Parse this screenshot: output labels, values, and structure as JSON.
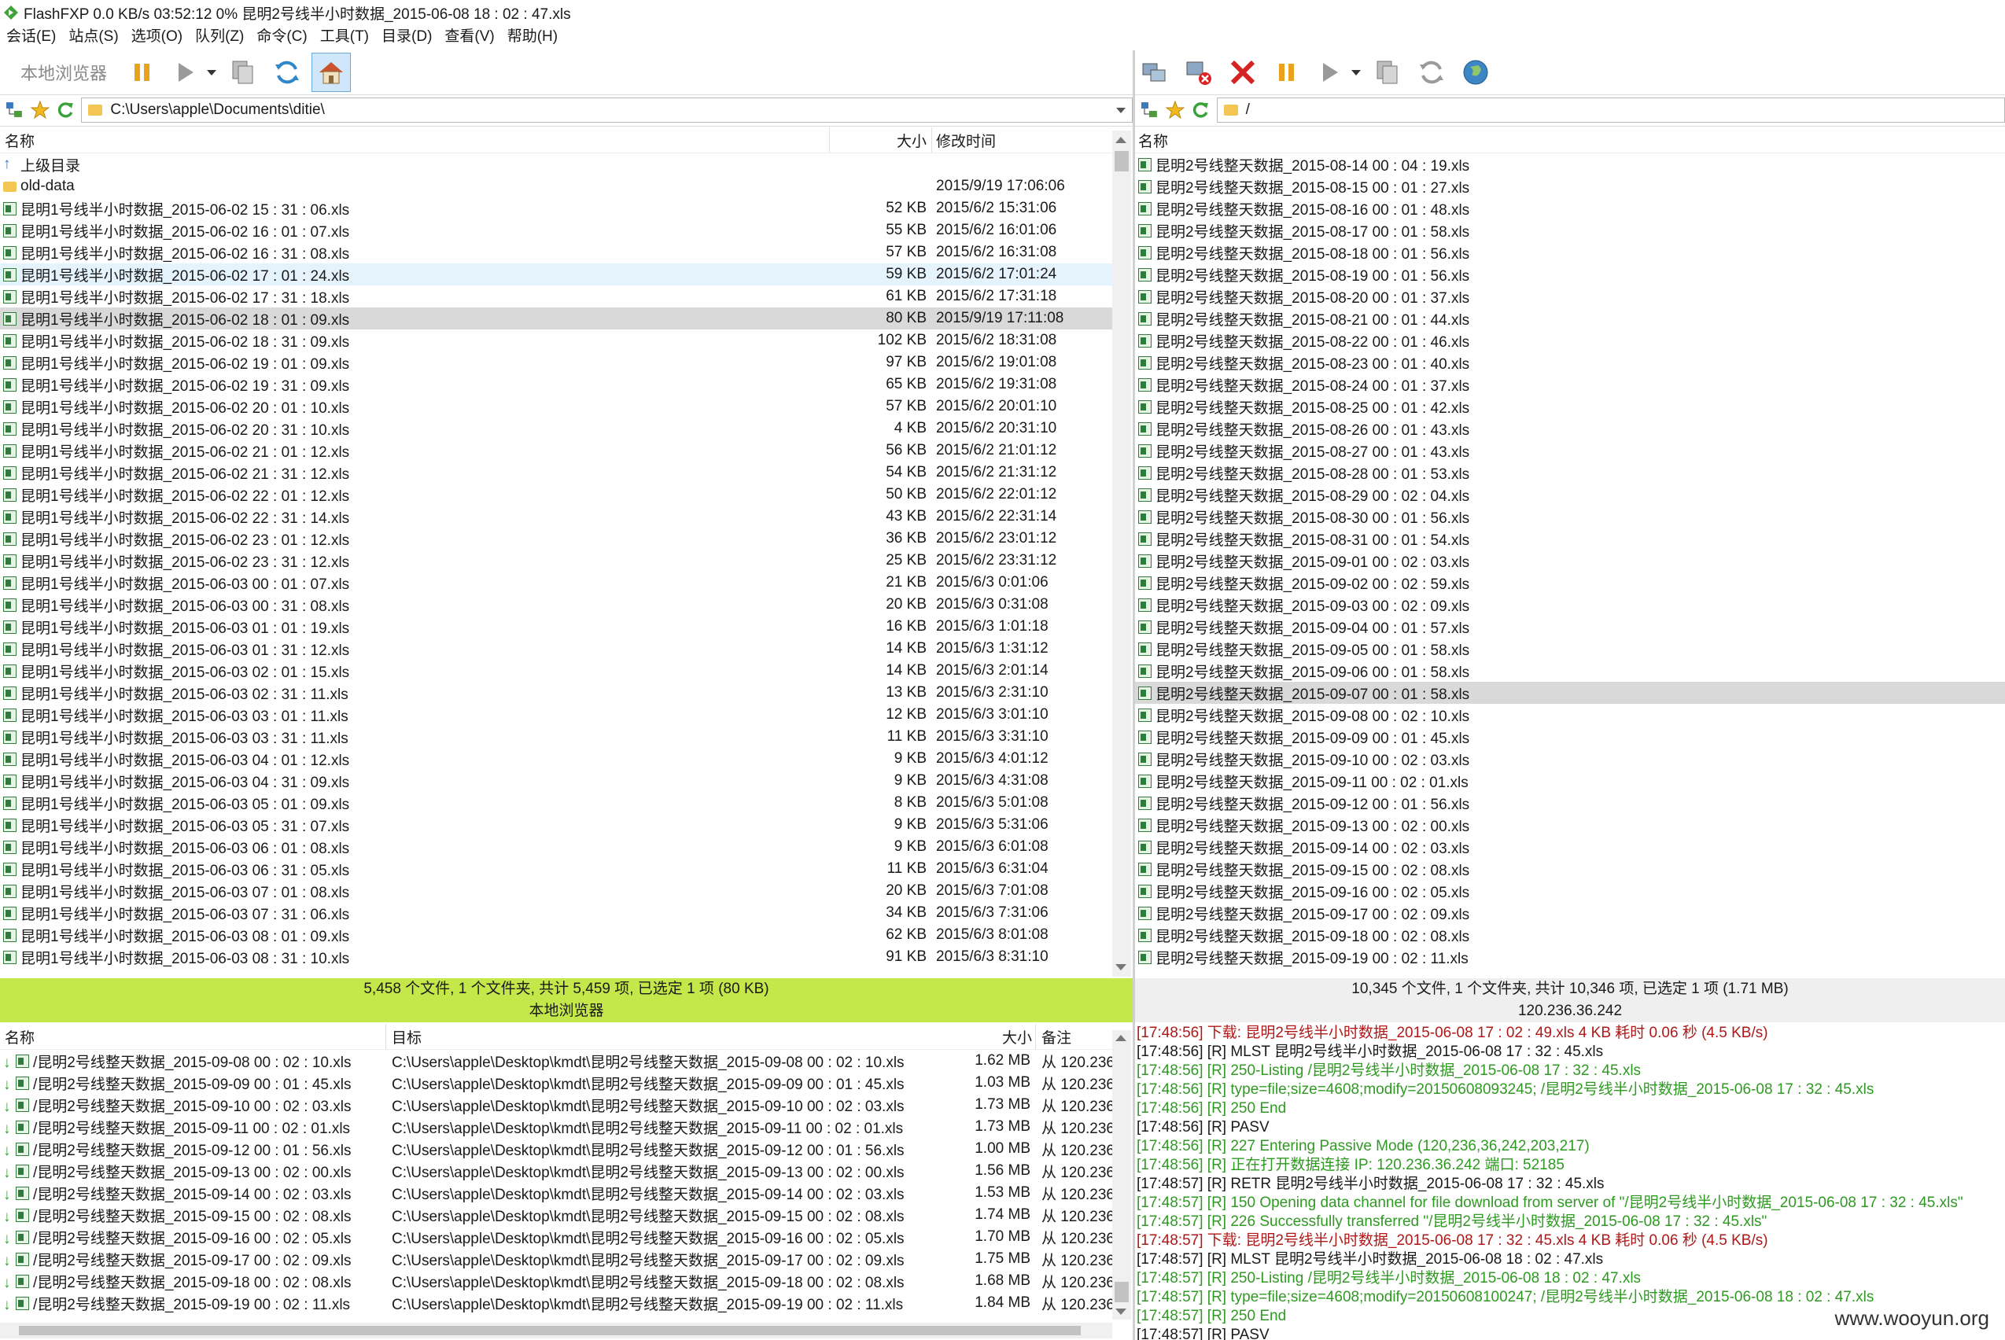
{
  "window": {
    "title": "FlashFXP 0.0 KB/s 03:52:12 0% 昆明2号线半小时数据_2015-06-08 18 : 02 : 47.xls"
  },
  "menu": [
    "会话(E)",
    "站点(S)",
    "选项(O)",
    "队列(Z)",
    "命令(C)",
    "工具(T)",
    "目录(D)",
    "查看(V)",
    "帮助(H)"
  ],
  "left": {
    "toolbar_label": "本地浏览器",
    "path": "C:\\Users\\apple\\Documents\\ditie\\",
    "columns": {
      "name": "名称",
      "size": "大小",
      "modified": "修改时间"
    },
    "up_label": "上级目录",
    "folder": {
      "name": "old-data",
      "modified": "2015/9/19 17:06:06"
    },
    "files": [
      [
        "昆明1号线半小时数据_2015-06-02 15 : 31 : 06.xls",
        "52 KB",
        "2015/6/2 15:31:06"
      ],
      [
        "昆明1号线半小时数据_2015-06-02 16 : 01 : 07.xls",
        "55 KB",
        "2015/6/2 16:01:06"
      ],
      [
        "昆明1号线半小时数据_2015-06-02 16 : 31 : 08.xls",
        "57 KB",
        "2015/6/2 16:31:08"
      ],
      [
        "昆明1号线半小时数据_2015-06-02 17 : 01 : 24.xls",
        "59 KB",
        "2015/6/2 17:01:24"
      ],
      [
        "昆明1号线半小时数据_2015-06-02 17 : 31 : 18.xls",
        "61 KB",
        "2015/6/2 17:31:18"
      ],
      [
        "昆明1号线半小时数据_2015-06-02 18 : 01 : 09.xls",
        "80 KB",
        "2015/9/19 17:11:08"
      ],
      [
        "昆明1号线半小时数据_2015-06-02 18 : 31 : 09.xls",
        "102 KB",
        "2015/6/2 18:31:08"
      ],
      [
        "昆明1号线半小时数据_2015-06-02 19 : 01 : 09.xls",
        "97 KB",
        "2015/6/2 19:01:08"
      ],
      [
        "昆明1号线半小时数据_2015-06-02 19 : 31 : 09.xls",
        "65 KB",
        "2015/6/2 19:31:08"
      ],
      [
        "昆明1号线半小时数据_2015-06-02 20 : 01 : 10.xls",
        "57 KB",
        "2015/6/2 20:01:10"
      ],
      [
        "昆明1号线半小时数据_2015-06-02 20 : 31 : 10.xls",
        "4 KB",
        "2015/6/2 20:31:10"
      ],
      [
        "昆明1号线半小时数据_2015-06-02 21 : 01 : 12.xls",
        "56 KB",
        "2015/6/2 21:01:12"
      ],
      [
        "昆明1号线半小时数据_2015-06-02 21 : 31 : 12.xls",
        "54 KB",
        "2015/6/2 21:31:12"
      ],
      [
        "昆明1号线半小时数据_2015-06-02 22 : 01 : 12.xls",
        "50 KB",
        "2015/6/2 22:01:12"
      ],
      [
        "昆明1号线半小时数据_2015-06-02 22 : 31 : 14.xls",
        "43 KB",
        "2015/6/2 22:31:14"
      ],
      [
        "昆明1号线半小时数据_2015-06-02 23 : 01 : 12.xls",
        "36 KB",
        "2015/6/2 23:01:12"
      ],
      [
        "昆明1号线半小时数据_2015-06-02 23 : 31 : 12.xls",
        "25 KB",
        "2015/6/2 23:31:12"
      ],
      [
        "昆明1号线半小时数据_2015-06-03 00 : 01 : 07.xls",
        "21 KB",
        "2015/6/3 0:01:06"
      ],
      [
        "昆明1号线半小时数据_2015-06-03 00 : 31 : 08.xls",
        "20 KB",
        "2015/6/3 0:31:08"
      ],
      [
        "昆明1号线半小时数据_2015-06-03 01 : 01 : 19.xls",
        "16 KB",
        "2015/6/3 1:01:18"
      ],
      [
        "昆明1号线半小时数据_2015-06-03 01 : 31 : 12.xls",
        "14 KB",
        "2015/6/3 1:31:12"
      ],
      [
        "昆明1号线半小时数据_2015-06-03 02 : 01 : 15.xls",
        "14 KB",
        "2015/6/3 2:01:14"
      ],
      [
        "昆明1号线半小时数据_2015-06-03 02 : 31 : 11.xls",
        "13 KB",
        "2015/6/3 2:31:10"
      ],
      [
        "昆明1号线半小时数据_2015-06-03 03 : 01 : 11.xls",
        "12 KB",
        "2015/6/3 3:01:10"
      ],
      [
        "昆明1号线半小时数据_2015-06-03 03 : 31 : 11.xls",
        "11 KB",
        "2015/6/3 3:31:10"
      ],
      [
        "昆明1号线半小时数据_2015-06-03 04 : 01 : 12.xls",
        "9 KB",
        "2015/6/3 4:01:12"
      ],
      [
        "昆明1号线半小时数据_2015-06-03 04 : 31 : 09.xls",
        "9 KB",
        "2015/6/3 4:31:08"
      ],
      [
        "昆明1号线半小时数据_2015-06-03 05 : 01 : 09.xls",
        "8 KB",
        "2015/6/3 5:01:08"
      ],
      [
        "昆明1号线半小时数据_2015-06-03 05 : 31 : 07.xls",
        "9 KB",
        "2015/6/3 5:31:06"
      ],
      [
        "昆明1号线半小时数据_2015-06-03 06 : 01 : 08.xls",
        "9 KB",
        "2015/6/3 6:01:08"
      ],
      [
        "昆明1号线半小时数据_2015-06-03 06 : 31 : 05.xls",
        "11 KB",
        "2015/6/3 6:31:04"
      ],
      [
        "昆明1号线半小时数据_2015-06-03 07 : 01 : 08.xls",
        "20 KB",
        "2015/6/3 7:01:08"
      ],
      [
        "昆明1号线半小时数据_2015-06-03 07 : 31 : 06.xls",
        "34 KB",
        "2015/6/3 7:31:06"
      ],
      [
        "昆明1号线半小时数据_2015-06-03 08 : 01 : 09.xls",
        "62 KB",
        "2015/6/3 8:01:08"
      ],
      [
        "昆明1号线半小时数据_2015-06-03 08 : 31 : 10.xls",
        "91 KB",
        "2015/6/3 8:31:10"
      ]
    ],
    "status": "5,458 个文件, 1 个文件夹, 共计 5,459 项, 已选定 1 项 (80 KB)",
    "status_label": "本地浏览器"
  },
  "right": {
    "path": "/",
    "columns": {
      "name": "名称"
    },
    "files": [
      "昆明2号线整天数据_2015-08-14 00 : 04 : 19.xls",
      "昆明2号线整天数据_2015-08-15 00 : 01 : 27.xls",
      "昆明2号线整天数据_2015-08-16 00 : 01 : 48.xls",
      "昆明2号线整天数据_2015-08-17 00 : 01 : 58.xls",
      "昆明2号线整天数据_2015-08-18 00 : 01 : 56.xls",
      "昆明2号线整天数据_2015-08-19 00 : 01 : 56.xls",
      "昆明2号线整天数据_2015-08-20 00 : 01 : 37.xls",
      "昆明2号线整天数据_2015-08-21 00 : 01 : 44.xls",
      "昆明2号线整天数据_2015-08-22 00 : 01 : 46.xls",
      "昆明2号线整天数据_2015-08-23 00 : 01 : 40.xls",
      "昆明2号线整天数据_2015-08-24 00 : 01 : 37.xls",
      "昆明2号线整天数据_2015-08-25 00 : 01 : 42.xls",
      "昆明2号线整天数据_2015-08-26 00 : 01 : 43.xls",
      "昆明2号线整天数据_2015-08-27 00 : 01 : 43.xls",
      "昆明2号线整天数据_2015-08-28 00 : 01 : 53.xls",
      "昆明2号线整天数据_2015-08-29 00 : 02 : 04.xls",
      "昆明2号线整天数据_2015-08-30 00 : 01 : 56.xls",
      "昆明2号线整天数据_2015-08-31 00 : 01 : 54.xls",
      "昆明2号线整天数据_2015-09-01 00 : 02 : 03.xls",
      "昆明2号线整天数据_2015-09-02 00 : 02 : 59.xls",
      "昆明2号线整天数据_2015-09-03 00 : 02 : 09.xls",
      "昆明2号线整天数据_2015-09-04 00 : 01 : 57.xls",
      "昆明2号线整天数据_2015-09-05 00 : 01 : 58.xls",
      "昆明2号线整天数据_2015-09-06 00 : 01 : 58.xls",
      "昆明2号线整天数据_2015-09-07 00 : 01 : 58.xls",
      "昆明2号线整天数据_2015-09-08 00 : 02 : 10.xls",
      "昆明2号线整天数据_2015-09-09 00 : 01 : 45.xls",
      "昆明2号线整天数据_2015-09-10 00 : 02 : 03.xls",
      "昆明2号线整天数据_2015-09-11 00 : 02 : 01.xls",
      "昆明2号线整天数据_2015-09-12 00 : 01 : 56.xls",
      "昆明2号线整天数据_2015-09-13 00 : 02 : 00.xls",
      "昆明2号线整天数据_2015-09-14 00 : 02 : 03.xls",
      "昆明2号线整天数据_2015-09-15 00 : 02 : 08.xls",
      "昆明2号线整天数据_2015-09-16 00 : 02 : 05.xls",
      "昆明2号线整天数据_2015-09-17 00 : 02 : 09.xls",
      "昆明2号线整天数据_2015-09-18 00 : 02 : 08.xls",
      "昆明2号线整天数据_2015-09-19 00 : 02 : 11.xls"
    ],
    "status": "10,345 个文件, 1 个文件夹, 共计 10,346 项, 已选定 1 项 (1.71 MB)",
    "server": "120.236.36.242"
  },
  "queue": {
    "columns": {
      "name": "名称",
      "target": "目标",
      "size": "大小",
      "note": "备注"
    },
    "items": [
      [
        "/昆明2号线整天数据_2015-09-08 00 : 02 : 10.xls",
        "C:\\Users\\apple\\Desktop\\kmdt\\昆明2号线整天数据_2015-09-08 00 : 02 : 10.xls",
        "1.62 MB",
        "从 120.236"
      ],
      [
        "/昆明2号线整天数据_2015-09-09 00 : 01 : 45.xls",
        "C:\\Users\\apple\\Desktop\\kmdt\\昆明2号线整天数据_2015-09-09 00 : 01 : 45.xls",
        "1.03 MB",
        "从 120.236"
      ],
      [
        "/昆明2号线整天数据_2015-09-10 00 : 02 : 03.xls",
        "C:\\Users\\apple\\Desktop\\kmdt\\昆明2号线整天数据_2015-09-10 00 : 02 : 03.xls",
        "1.73 MB",
        "从 120.236"
      ],
      [
        "/昆明2号线整天数据_2015-09-11 00 : 02 : 01.xls",
        "C:\\Users\\apple\\Desktop\\kmdt\\昆明2号线整天数据_2015-09-11 00 : 02 : 01.xls",
        "1.73 MB",
        "从 120.236"
      ],
      [
        "/昆明2号线整天数据_2015-09-12 00 : 01 : 56.xls",
        "C:\\Users\\apple\\Desktop\\kmdt\\昆明2号线整天数据_2015-09-12 00 : 01 : 56.xls",
        "1.00 MB",
        "从 120.236"
      ],
      [
        "/昆明2号线整天数据_2015-09-13 00 : 02 : 00.xls",
        "C:\\Users\\apple\\Desktop\\kmdt\\昆明2号线整天数据_2015-09-13 00 : 02 : 00.xls",
        "1.56 MB",
        "从 120.236"
      ],
      [
        "/昆明2号线整天数据_2015-09-14 00 : 02 : 03.xls",
        "C:\\Users\\apple\\Desktop\\kmdt\\昆明2号线整天数据_2015-09-14 00 : 02 : 03.xls",
        "1.53 MB",
        "从 120.236"
      ],
      [
        "/昆明2号线整天数据_2015-09-15 00 : 02 : 08.xls",
        "C:\\Users\\apple\\Desktop\\kmdt\\昆明2号线整天数据_2015-09-15 00 : 02 : 08.xls",
        "1.74 MB",
        "从 120.236"
      ],
      [
        "/昆明2号线整天数据_2015-09-16 00 : 02 : 05.xls",
        "C:\\Users\\apple\\Desktop\\kmdt\\昆明2号线整天数据_2015-09-16 00 : 02 : 05.xls",
        "1.70 MB",
        "从 120.236"
      ],
      [
        "/昆明2号线整天数据_2015-09-17 00 : 02 : 09.xls",
        "C:\\Users\\apple\\Desktop\\kmdt\\昆明2号线整天数据_2015-09-17 00 : 02 : 09.xls",
        "1.75 MB",
        "从 120.236"
      ],
      [
        "/昆明2号线整天数据_2015-09-18 00 : 02 : 08.xls",
        "C:\\Users\\apple\\Desktop\\kmdt\\昆明2号线整天数据_2015-09-18 00 : 02 : 08.xls",
        "1.68 MB",
        "从 120.236"
      ],
      [
        "/昆明2号线整天数据_2015-09-19 00 : 02 : 11.xls",
        "C:\\Users\\apple\\Desktop\\kmdt\\昆明2号线整天数据_2015-09-19 00 : 02 : 11.xls",
        "1.84 MB",
        "从 120.236"
      ]
    ]
  },
  "log": [
    [
      "red",
      "[17:48:56] 下载: 昆明2号线半小时数据_2015-06-08 17 : 02 : 49.xls 4 KB 耗时 0.06 秒 (4.5 KB/s)"
    ],
    [
      "black",
      "[17:48:56] [R] MLST 昆明2号线半小时数据_2015-06-08 17 : 32 : 45.xls"
    ],
    [
      "green",
      "[17:48:56] [R] 250-Listing /昆明2号线半小时数据_2015-06-08 17 : 32 : 45.xls"
    ],
    [
      "green",
      "[17:48:56] [R]  type=file;size=4608;modify=20150608093245; /昆明2号线半小时数据_2015-06-08 17 : 32 : 45.xls"
    ],
    [
      "green",
      "[17:48:56] [R] 250 End"
    ],
    [
      "black",
      "[17:48:56] [R] PASV"
    ],
    [
      "green",
      "[17:48:56] [R] 227 Entering Passive Mode (120,236,36,242,203,217)"
    ],
    [
      "green",
      "[17:48:56] [R] 正在打开数据连接 IP: 120.236.36.242 端口: 52185"
    ],
    [
      "black",
      "[17:48:57] [R] RETR 昆明2号线半小时数据_2015-06-08 17 : 32 : 45.xls"
    ],
    [
      "green",
      "[17:48:57] [R] 150 Opening data channel for file download from server of \"/昆明2号线半小时数据_2015-06-08 17 : 32 : 45.xls\""
    ],
    [
      "green",
      "[17:48:57] [R] 226 Successfully transferred \"/昆明2号线半小时数据_2015-06-08 17 : 32 : 45.xls\""
    ],
    [
      "red",
      "[17:48:57] 下载: 昆明2号线半小时数据_2015-06-08 17 : 32 : 45.xls 4 KB 耗时 0.06 秒 (4.5 KB/s)"
    ],
    [
      "black",
      "[17:48:57] [R] MLST 昆明2号线半小时数据_2015-06-08 18 : 02 : 47.xls"
    ],
    [
      "green",
      "[17:48:57] [R] 250-Listing /昆明2号线半小时数据_2015-06-08 18 : 02 : 47.xls"
    ],
    [
      "green",
      "[17:48:57] [R]  type=file;size=4608;modify=20150608100247; /昆明2号线半小时数据_2015-06-08 18 : 02 : 47.xls"
    ],
    [
      "green",
      "[17:48:57] [R] 250 End"
    ],
    [
      "black",
      "[17:48:57] [R] PASV"
    ]
  ],
  "watermark": "www.wooyun.org",
  "colors": {
    "status_green": "#c4e84a",
    "selected_row": "#d9d9d9",
    "hover_row": "#e5f3fd",
    "log_red": "#b01818",
    "log_green": "#2f9a22"
  }
}
